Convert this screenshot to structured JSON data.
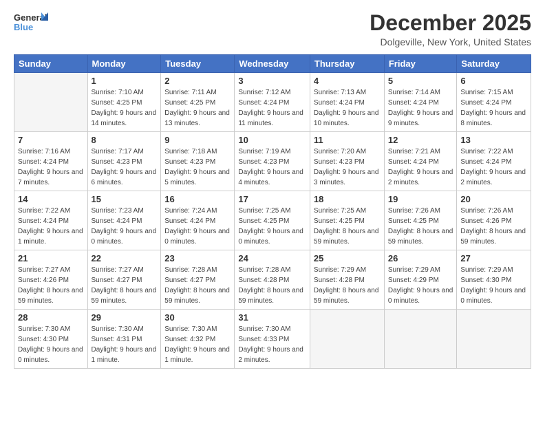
{
  "header": {
    "logo_general": "General",
    "logo_blue": "Blue",
    "title": "December 2025",
    "location": "Dolgeville, New York, United States"
  },
  "calendar": {
    "days_of_week": [
      "Sunday",
      "Monday",
      "Tuesday",
      "Wednesday",
      "Thursday",
      "Friday",
      "Saturday"
    ],
    "weeks": [
      [
        {
          "day": "",
          "empty": true
        },
        {
          "day": "1",
          "sunrise": "Sunrise: 7:10 AM",
          "sunset": "Sunset: 4:25 PM",
          "daylight": "Daylight: 9 hours and 14 minutes."
        },
        {
          "day": "2",
          "sunrise": "Sunrise: 7:11 AM",
          "sunset": "Sunset: 4:25 PM",
          "daylight": "Daylight: 9 hours and 13 minutes."
        },
        {
          "day": "3",
          "sunrise": "Sunrise: 7:12 AM",
          "sunset": "Sunset: 4:24 PM",
          "daylight": "Daylight: 9 hours and 11 minutes."
        },
        {
          "day": "4",
          "sunrise": "Sunrise: 7:13 AM",
          "sunset": "Sunset: 4:24 PM",
          "daylight": "Daylight: 9 hours and 10 minutes."
        },
        {
          "day": "5",
          "sunrise": "Sunrise: 7:14 AM",
          "sunset": "Sunset: 4:24 PM",
          "daylight": "Daylight: 9 hours and 9 minutes."
        },
        {
          "day": "6",
          "sunrise": "Sunrise: 7:15 AM",
          "sunset": "Sunset: 4:24 PM",
          "daylight": "Daylight: 9 hours and 8 minutes."
        }
      ],
      [
        {
          "day": "7",
          "sunrise": "Sunrise: 7:16 AM",
          "sunset": "Sunset: 4:24 PM",
          "daylight": "Daylight: 9 hours and 7 minutes."
        },
        {
          "day": "8",
          "sunrise": "Sunrise: 7:17 AM",
          "sunset": "Sunset: 4:23 PM",
          "daylight": "Daylight: 9 hours and 6 minutes."
        },
        {
          "day": "9",
          "sunrise": "Sunrise: 7:18 AM",
          "sunset": "Sunset: 4:23 PM",
          "daylight": "Daylight: 9 hours and 5 minutes."
        },
        {
          "day": "10",
          "sunrise": "Sunrise: 7:19 AM",
          "sunset": "Sunset: 4:23 PM",
          "daylight": "Daylight: 9 hours and 4 minutes."
        },
        {
          "day": "11",
          "sunrise": "Sunrise: 7:20 AM",
          "sunset": "Sunset: 4:23 PM",
          "daylight": "Daylight: 9 hours and 3 minutes."
        },
        {
          "day": "12",
          "sunrise": "Sunrise: 7:21 AM",
          "sunset": "Sunset: 4:24 PM",
          "daylight": "Daylight: 9 hours and 2 minutes."
        },
        {
          "day": "13",
          "sunrise": "Sunrise: 7:22 AM",
          "sunset": "Sunset: 4:24 PM",
          "daylight": "Daylight: 9 hours and 2 minutes."
        }
      ],
      [
        {
          "day": "14",
          "sunrise": "Sunrise: 7:22 AM",
          "sunset": "Sunset: 4:24 PM",
          "daylight": "Daylight: 9 hours and 1 minute."
        },
        {
          "day": "15",
          "sunrise": "Sunrise: 7:23 AM",
          "sunset": "Sunset: 4:24 PM",
          "daylight": "Daylight: 9 hours and 0 minutes."
        },
        {
          "day": "16",
          "sunrise": "Sunrise: 7:24 AM",
          "sunset": "Sunset: 4:24 PM",
          "daylight": "Daylight: 9 hours and 0 minutes."
        },
        {
          "day": "17",
          "sunrise": "Sunrise: 7:25 AM",
          "sunset": "Sunset: 4:25 PM",
          "daylight": "Daylight: 9 hours and 0 minutes."
        },
        {
          "day": "18",
          "sunrise": "Sunrise: 7:25 AM",
          "sunset": "Sunset: 4:25 PM",
          "daylight": "Daylight: 8 hours and 59 minutes."
        },
        {
          "day": "19",
          "sunrise": "Sunrise: 7:26 AM",
          "sunset": "Sunset: 4:25 PM",
          "daylight": "Daylight: 8 hours and 59 minutes."
        },
        {
          "day": "20",
          "sunrise": "Sunrise: 7:26 AM",
          "sunset": "Sunset: 4:26 PM",
          "daylight": "Daylight: 8 hours and 59 minutes."
        }
      ],
      [
        {
          "day": "21",
          "sunrise": "Sunrise: 7:27 AM",
          "sunset": "Sunset: 4:26 PM",
          "daylight": "Daylight: 8 hours and 59 minutes."
        },
        {
          "day": "22",
          "sunrise": "Sunrise: 7:27 AM",
          "sunset": "Sunset: 4:27 PM",
          "daylight": "Daylight: 8 hours and 59 minutes."
        },
        {
          "day": "23",
          "sunrise": "Sunrise: 7:28 AM",
          "sunset": "Sunset: 4:27 PM",
          "daylight": "Daylight: 8 hours and 59 minutes."
        },
        {
          "day": "24",
          "sunrise": "Sunrise: 7:28 AM",
          "sunset": "Sunset: 4:28 PM",
          "daylight": "Daylight: 8 hours and 59 minutes."
        },
        {
          "day": "25",
          "sunrise": "Sunrise: 7:29 AM",
          "sunset": "Sunset: 4:28 PM",
          "daylight": "Daylight: 8 hours and 59 minutes."
        },
        {
          "day": "26",
          "sunrise": "Sunrise: 7:29 AM",
          "sunset": "Sunset: 4:29 PM",
          "daylight": "Daylight: 9 hours and 0 minutes."
        },
        {
          "day": "27",
          "sunrise": "Sunrise: 7:29 AM",
          "sunset": "Sunset: 4:30 PM",
          "daylight": "Daylight: 9 hours and 0 minutes."
        }
      ],
      [
        {
          "day": "28",
          "sunrise": "Sunrise: 7:30 AM",
          "sunset": "Sunset: 4:30 PM",
          "daylight": "Daylight: 9 hours and 0 minutes."
        },
        {
          "day": "29",
          "sunrise": "Sunrise: 7:30 AM",
          "sunset": "Sunset: 4:31 PM",
          "daylight": "Daylight: 9 hours and 1 minute."
        },
        {
          "day": "30",
          "sunrise": "Sunrise: 7:30 AM",
          "sunset": "Sunset: 4:32 PM",
          "daylight": "Daylight: 9 hours and 1 minute."
        },
        {
          "day": "31",
          "sunrise": "Sunrise: 7:30 AM",
          "sunset": "Sunset: 4:33 PM",
          "daylight": "Daylight: 9 hours and 2 minutes."
        },
        {
          "day": "",
          "empty": true
        },
        {
          "day": "",
          "empty": true
        },
        {
          "day": "",
          "empty": true
        }
      ]
    ]
  }
}
